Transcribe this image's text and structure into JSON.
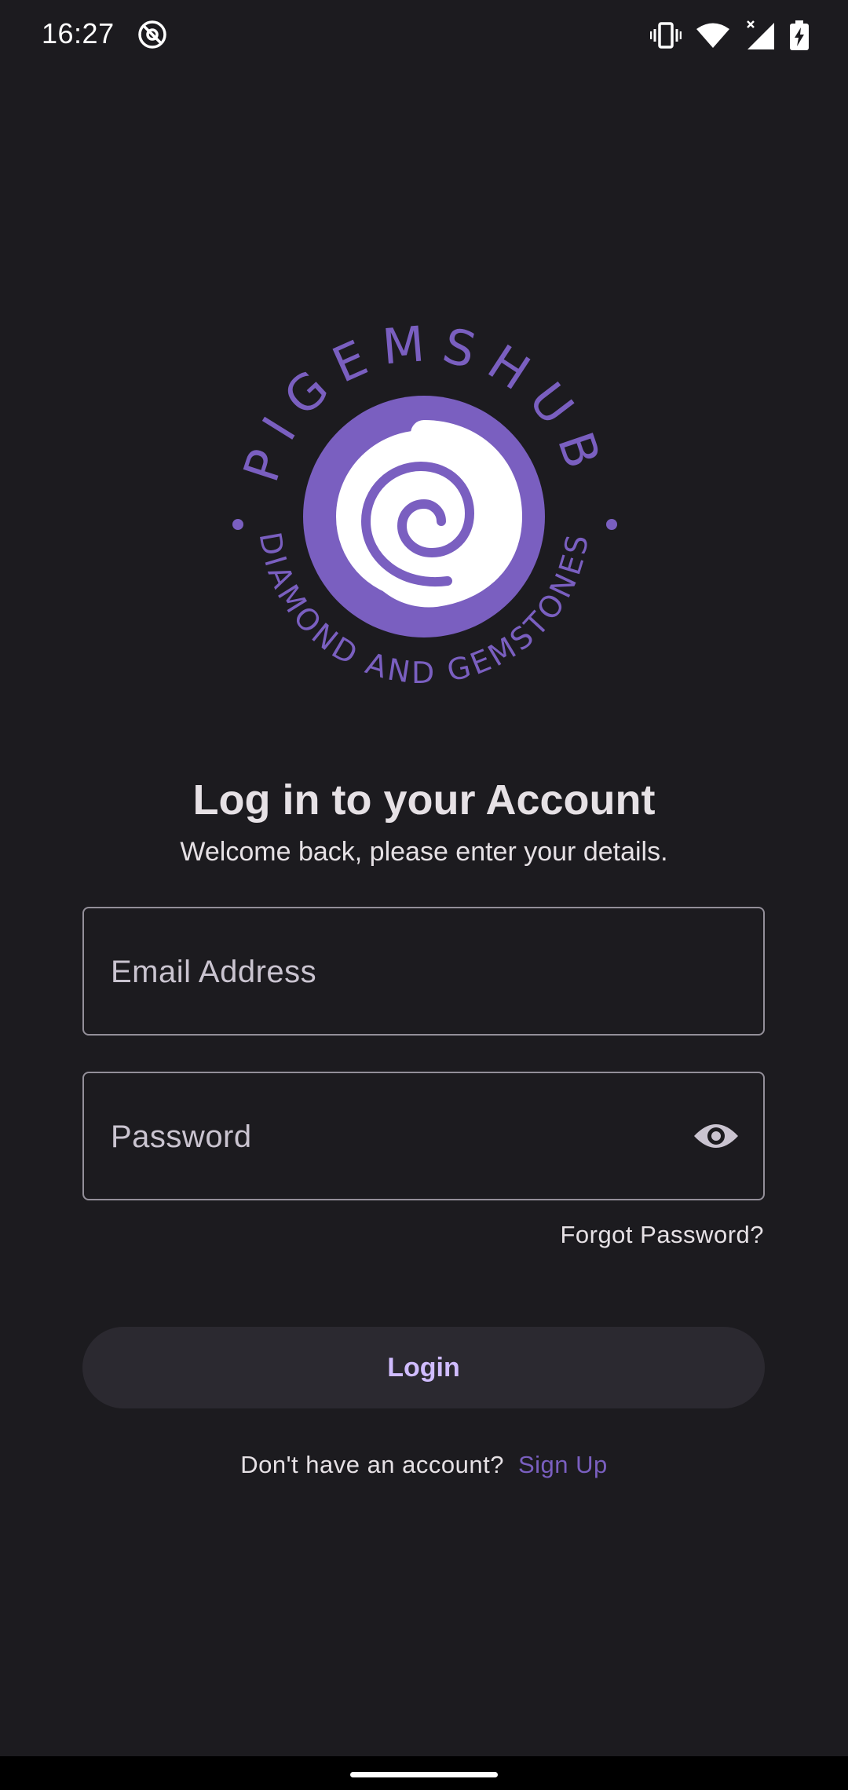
{
  "status_bar": {
    "time": "16:27",
    "icons": [
      "at-sign-icon",
      "vibrate-icon",
      "wifi-icon",
      "cell-signal-icon",
      "battery-charging-icon"
    ]
  },
  "logo": {
    "brand": "PIGEMSHUB",
    "tagline": "DIAMOND AND GEMSTONES",
    "color": "#7a5fc0"
  },
  "header": {
    "title": "Log in to your Account",
    "subtitle": "Welcome back, please enter your details."
  },
  "form": {
    "email": {
      "placeholder": "Email Address",
      "value": ""
    },
    "password": {
      "placeholder": "Password",
      "value": "",
      "toggle_icon": "eye-icon"
    },
    "forgot_label": "Forgot Password?",
    "login_label": "Login"
  },
  "footer": {
    "prompt": "Don't have an account?",
    "signup_label": "Sign Up"
  },
  "colors": {
    "background": "#1c1b1f",
    "accent": "#7a5fc0",
    "button_text": "#d0bcff",
    "button_bg": "#2b2930"
  }
}
